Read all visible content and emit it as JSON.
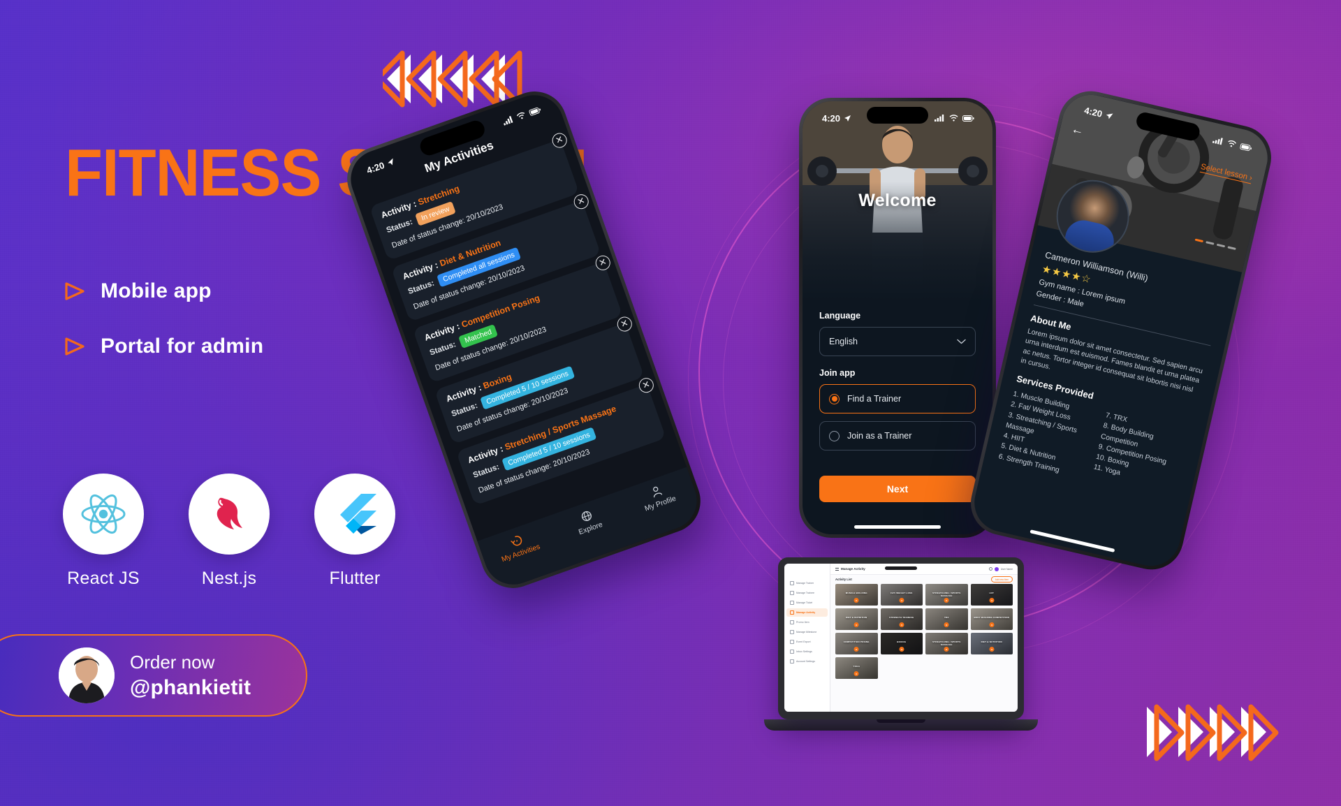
{
  "hero": {
    "title": "FITNESS SYSTEM",
    "bullets": [
      {
        "label": "Mobile app"
      },
      {
        "label": "Portal for admin"
      }
    ]
  },
  "stacks": [
    {
      "name": "React JS",
      "icon": "react-icon"
    },
    {
      "name": "Nest.js",
      "icon": "nestjs-icon"
    },
    {
      "name": "Flutter",
      "icon": "flutter-icon"
    }
  ],
  "order_badge": {
    "line1": "Order now",
    "line2": "@phankietit"
  },
  "phone1": {
    "status_time": "4:20",
    "title": "My Activities",
    "close_icon": "✕",
    "labels": {
      "activity": "Activity :",
      "status": "Status:",
      "date": "Date of status change:"
    },
    "activities": [
      {
        "name": "Stretching",
        "status": "In review",
        "status_color": "#f2a15c",
        "date": "20/10/2023"
      },
      {
        "name": "Diet & Nutrition",
        "status": "Completed all sessions",
        "status_color": "#2f8ef4",
        "date": "20/10/2023"
      },
      {
        "name": "Competition Posing",
        "status": "Matched",
        "status_color": "#33c24d",
        "date": "20/10/2023"
      },
      {
        "name": "Boxing",
        "status": "Completed 5 / 10 sessions",
        "status_color": "#34b4e0",
        "date": "20/10/2023"
      },
      {
        "name": "Stretching / Sports Massage",
        "status": "Completed 5 / 10 sessions",
        "status_color": "#34b4e0",
        "date": "20/10/2023"
      }
    ],
    "nav": [
      {
        "label": "My Activities",
        "icon": "history-icon",
        "active": true
      },
      {
        "label": "Explore",
        "icon": "globe-icon",
        "active": false
      },
      {
        "label": "My Profile",
        "icon": "person-icon",
        "active": false
      }
    ]
  },
  "phone2": {
    "status_time": "4:20",
    "welcome": "Welcome",
    "language_label": "Language",
    "language_value": "English",
    "join_label": "Join app",
    "options": [
      {
        "label": "Find a Trainer",
        "selected": true
      },
      {
        "label": "Join as a Trainer",
        "selected": false
      }
    ],
    "next_button": "Next"
  },
  "phone3": {
    "status_time": "4:20",
    "back_icon": "←",
    "select_lesson": "Select lesson ›",
    "name": "Cameron Williamson",
    "nickname": "(Willi)",
    "stars_filled": 4,
    "stars_total": 5,
    "gym_name": "Gym name : Lorem ipsum",
    "gender": "Gender : Male",
    "about_heading": "About Me",
    "about_text": "Lorem ipsum dolor sit amet consectetur. Sed sapien arcu urna interdum est euismod. Fames blandit et urna platea ac netus. Tortor integer id consequat sit lobortis nisi nisl in cursus.",
    "services_heading": "Services Provided",
    "services_left": [
      "1. Muscle Building",
      "2. Fat/ Weight Loss",
      "3. Streatching / Sports Massage",
      "4. HIIT",
      "5. Diet & Nutrition",
      "6. Strength Training"
    ],
    "services_right": [
      "7. TRX",
      "8. Body Building Competition",
      "9. Competition Posing",
      "10. Boxing",
      "11. Yoga"
    ]
  },
  "laptop": {
    "topbar_title": "Manage Activity",
    "username": "User Name",
    "section_title": "Activity List",
    "add_button": "Add new item",
    "sidebar": [
      {
        "label": "Manage Trainer",
        "active": false
      },
      {
        "label": "Manage Trainee",
        "active": false
      },
      {
        "label": "Manage Ticket",
        "active": false
      },
      {
        "label": "Manage Activity",
        "active": true
      },
      {
        "label": "Promo Item",
        "active": false
      },
      {
        "label": "Manage Milestone",
        "active": false
      },
      {
        "label": "Event Export",
        "active": false
      },
      {
        "label": "Inbox Settings",
        "active": false
      },
      {
        "label": "Account Settings",
        "active": false
      }
    ],
    "cards": [
      "MUSCLE BUILDING",
      "FAT/ WEIGHT LOSS",
      "STREATCHING / SPORTS MASSAGE",
      "HIIT",
      "DIET & NUTRITION",
      "STRENGTH TRAINING",
      "TRX",
      "BODY BUILDING COMPETITION",
      "COMPETITION POSING",
      "BOXING",
      "STREATCHING / SPORTS MASSAGE",
      "DIET & NUTRITION",
      "YOGA"
    ]
  },
  "colors": {
    "accent": "#f97316",
    "bg_purple": "#6b2fc0",
    "white": "#ffffff"
  }
}
